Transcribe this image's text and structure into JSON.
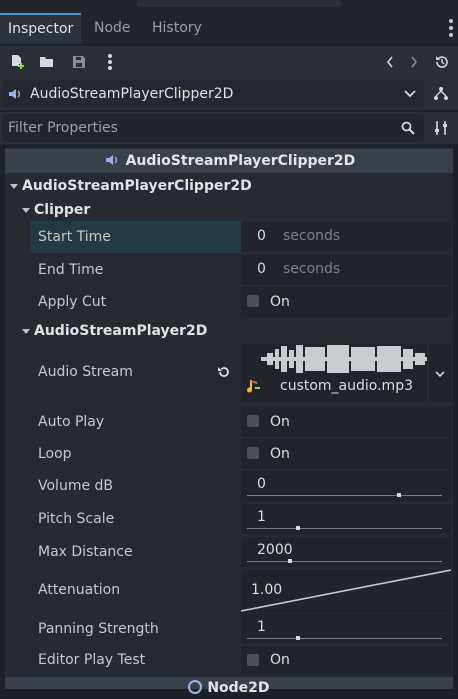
{
  "tabs": [
    {
      "label": "Inspector",
      "active": true
    },
    {
      "label": "Node",
      "active": false
    },
    {
      "label": "History",
      "active": false
    }
  ],
  "toolbar": {
    "icons": [
      "new-resource-icon",
      "open-folder-icon",
      "save-icon",
      "more-options-icon",
      "history-back-icon",
      "history-forward-icon",
      "object-history-icon"
    ]
  },
  "object_selector": {
    "value": "AudioStreamPlayerClipper2D",
    "icon": "audio-speaker-icon"
  },
  "filter": {
    "placeholder": "Filter Properties"
  },
  "class_header": "AudioStreamPlayerClipper2D",
  "sections": {
    "main": "AudioStreamPlayerClipper2D",
    "clipper": "Clipper",
    "player": "AudioStreamPlayer2D"
  },
  "properties": {
    "start_time": {
      "label": "Start Time",
      "value": "0",
      "unit": "seconds"
    },
    "end_time": {
      "label": "End Time",
      "value": "0",
      "unit": "seconds"
    },
    "apply_cut": {
      "label": "Apply Cut",
      "toggle": "On",
      "checked": false
    },
    "audio_stream": {
      "label": "Audio Stream",
      "file": "custom_audio.mp3"
    },
    "auto_play": {
      "label": "Auto Play",
      "toggle": "On",
      "checked": false
    },
    "loop": {
      "label": "Loop",
      "toggle": "On",
      "checked": false
    },
    "volume_db": {
      "label": "Volume dB",
      "value": "0",
      "slider_fraction": 0.78
    },
    "pitch_scale": {
      "label": "Pitch Scale",
      "value": "1",
      "slider_fraction": 0.26
    },
    "max_distance": {
      "label": "Max Distance",
      "value": "2000",
      "slider_fraction": 0.22
    },
    "attenuation": {
      "label": "Attenuation",
      "value": "1.00"
    },
    "panning_strength": {
      "label": "Panning Strength",
      "value": "1",
      "slider_fraction": 0.26
    },
    "editor_play_test": {
      "label": "Editor Play Test",
      "toggle": "On",
      "checked": false
    }
  },
  "footer_section": "Node2D",
  "colors": {
    "accent": "#5d8bd8",
    "selected_row": "#233a45",
    "panel_bg": "#262b33"
  }
}
